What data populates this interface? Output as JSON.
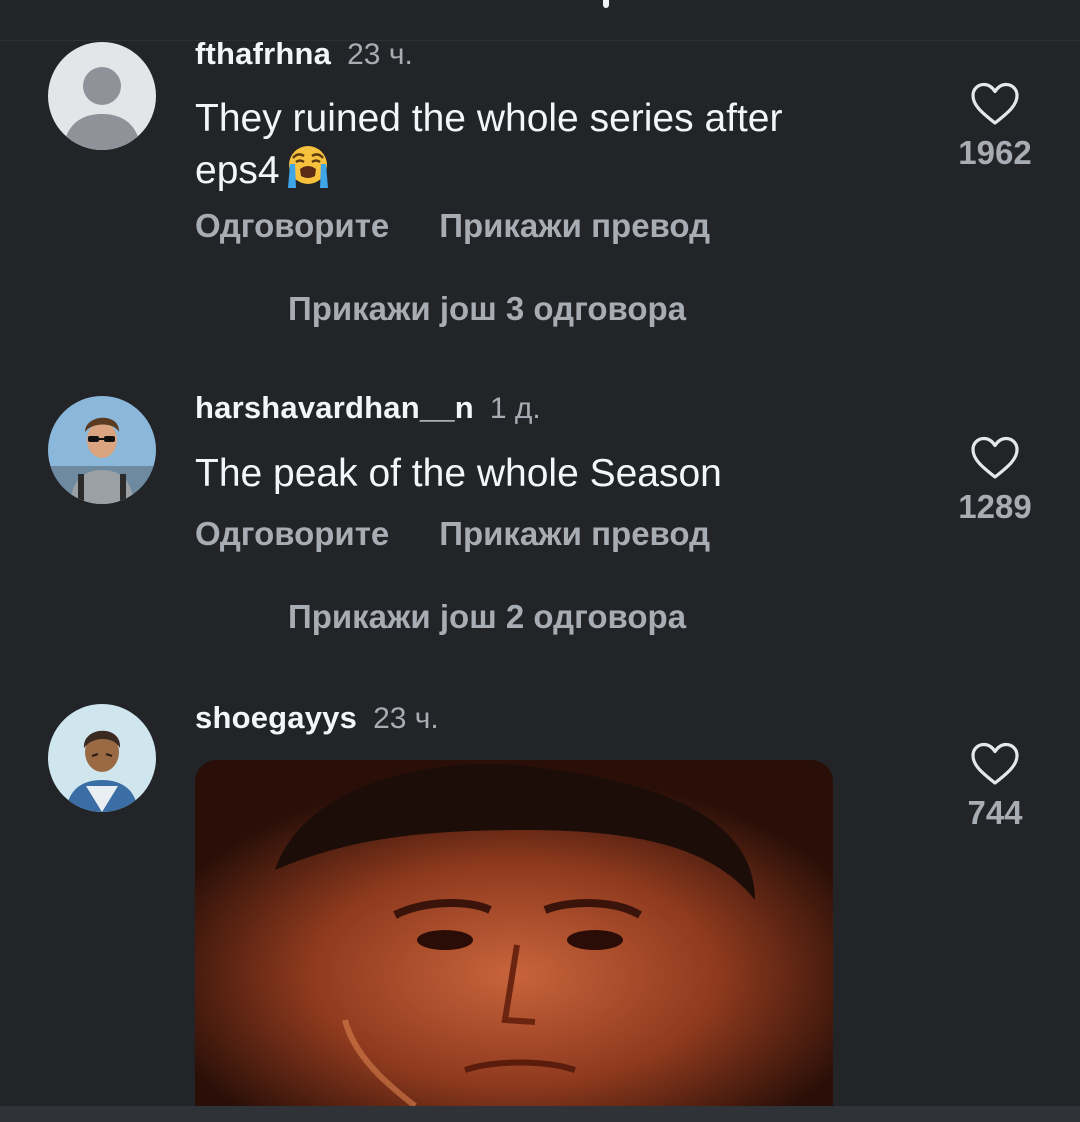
{
  "comments": [
    {
      "username": "fthafrhna",
      "time": "23 ч.",
      "text_line1": "They ruined the whole series after",
      "text_line2": "eps4",
      "emoji": "loudly-crying-face",
      "reply_label": "Одговорите",
      "translate_label": "Прикажи превод",
      "more_replies": "Прикажи још 3 одговора",
      "like_count": "1962"
    },
    {
      "username": "harshavardhan__n",
      "time": "1 д.",
      "text_line1": "The peak of the whole Season",
      "reply_label": "Одговорите",
      "translate_label": "Прикажи превод",
      "more_replies": "Прикажи још 2 одговора",
      "like_count": "1289"
    },
    {
      "username": "shoegayys",
      "time": "23 ч.",
      "attachment": "gif-image",
      "like_count": "744"
    }
  ],
  "colors": {
    "background": "#222428",
    "primary_text": "#f4f5f7",
    "secondary_text": "#a8acb3"
  },
  "icons": [
    "default-avatar-icon",
    "heart-outline-icon"
  ]
}
